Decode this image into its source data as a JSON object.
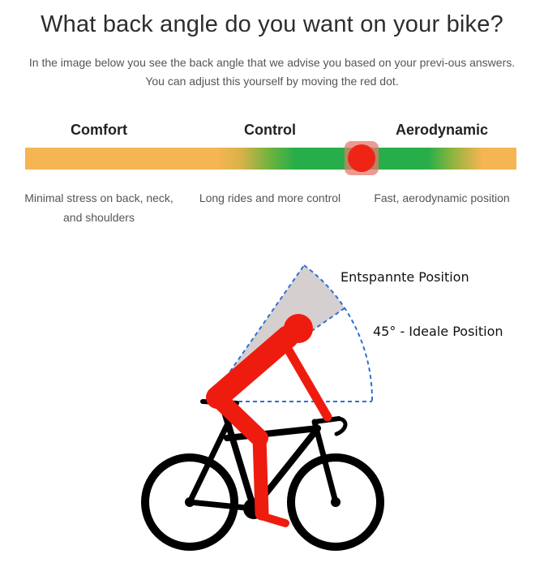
{
  "header": {
    "title": "What back angle do you want on your bike?",
    "subtitle": "In the image below you see the back angle that we advise you based on your previ-ous answers. You can adjust this yourself by moving the red dot."
  },
  "slider": {
    "stages": [
      {
        "label": "Comfort",
        "description": "Minimal stress on back, neck, and shoulders"
      },
      {
        "label": "Control",
        "description": "Long rides and more control"
      },
      {
        "label": "Aerodynamic",
        "description": "Fast, aerodynamic position"
      }
    ],
    "value_fraction": 0.69,
    "colors": {
      "comfort": "#f5b552",
      "control": "#27ae4a",
      "handle": "#ee2516"
    }
  },
  "figure": {
    "label_relaxed": "Entspannte Position",
    "label_ideal": "45° - Ideale Position",
    "colors": {
      "rider": "#ee1c0f",
      "bike": "#000000",
      "arc": "#2f6fd6",
      "sector": "#d6cfcf"
    }
  }
}
